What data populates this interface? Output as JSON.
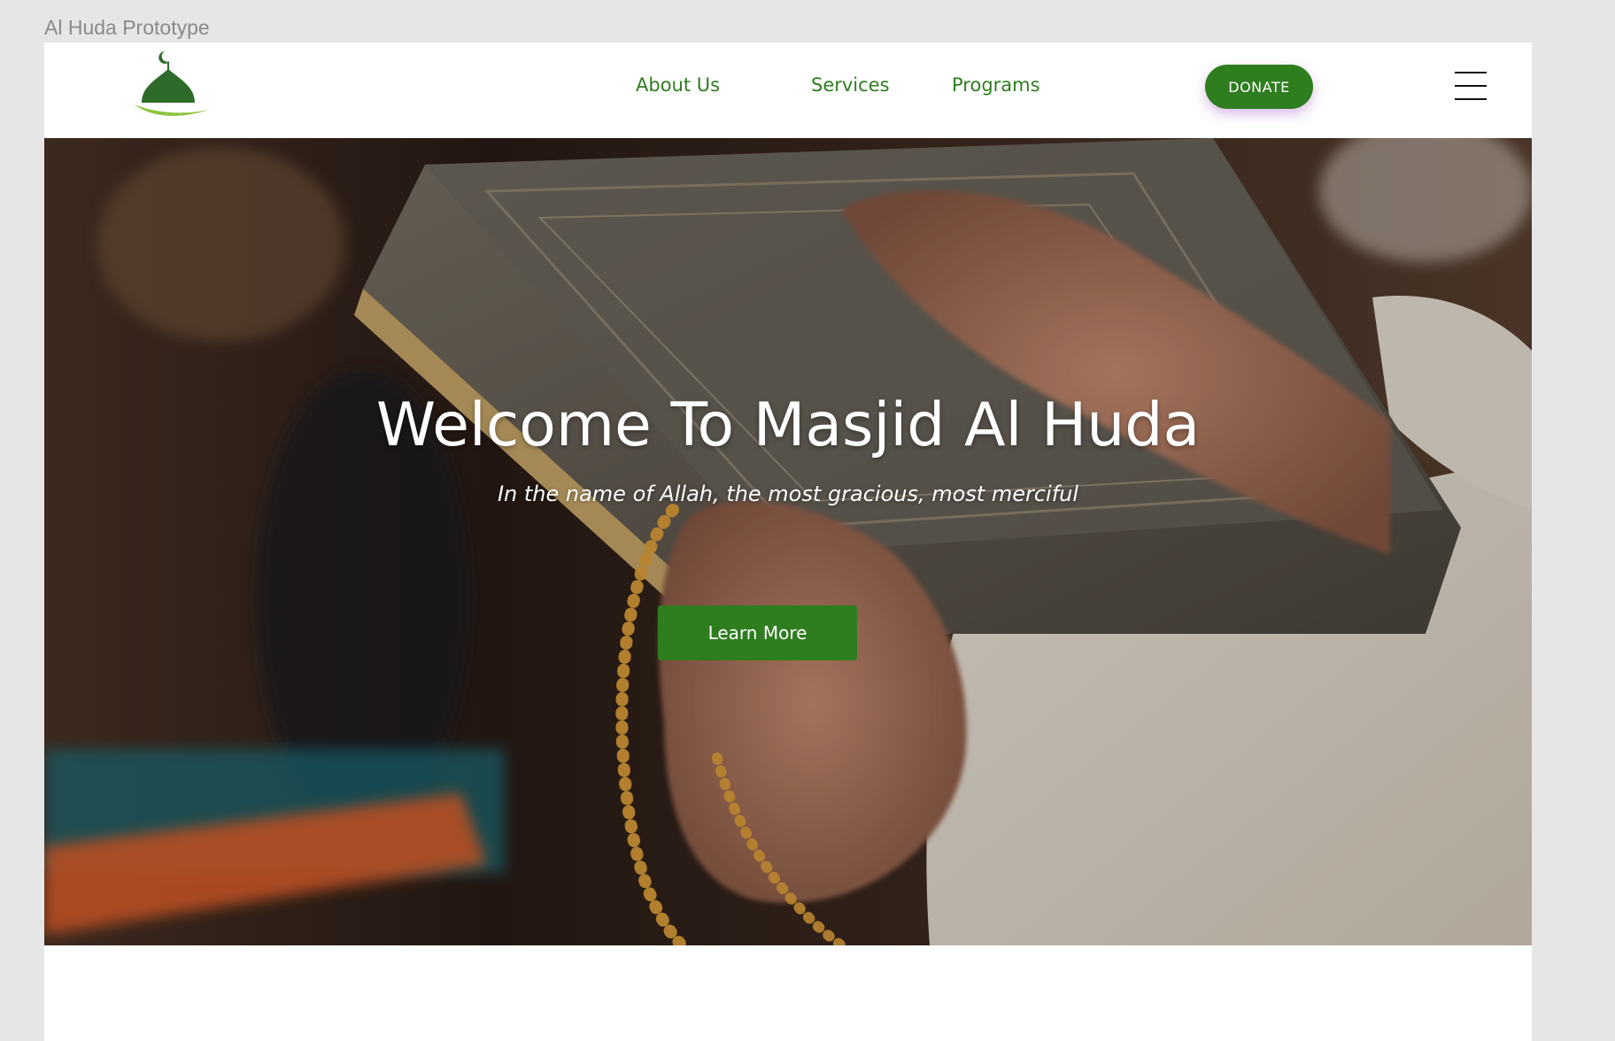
{
  "prototype_label": "Al Huda Prototype",
  "header": {
    "logo_icon": "mosque-dome-logo-icon",
    "nav": [
      {
        "label": "About Us"
      },
      {
        "label": "Services"
      },
      {
        "label": "Programs"
      }
    ],
    "donate_label": "DONATE",
    "menu_icon": "hamburger-menu-icon"
  },
  "hero": {
    "title": "Welcome To Masjid Al Huda",
    "subtitle": "In the name of Allah, the most gracious, most merciful",
    "cta_label": "Learn More",
    "background": "hands-holding-quran-with-prayer-beads-photo"
  },
  "colors": {
    "brand_green": "#2e7d1f",
    "logo_green": "#2e6b2a",
    "logo_accent": "#8dc63f",
    "page_background": "#e6e6e6",
    "nav_background": "#ffffff"
  }
}
